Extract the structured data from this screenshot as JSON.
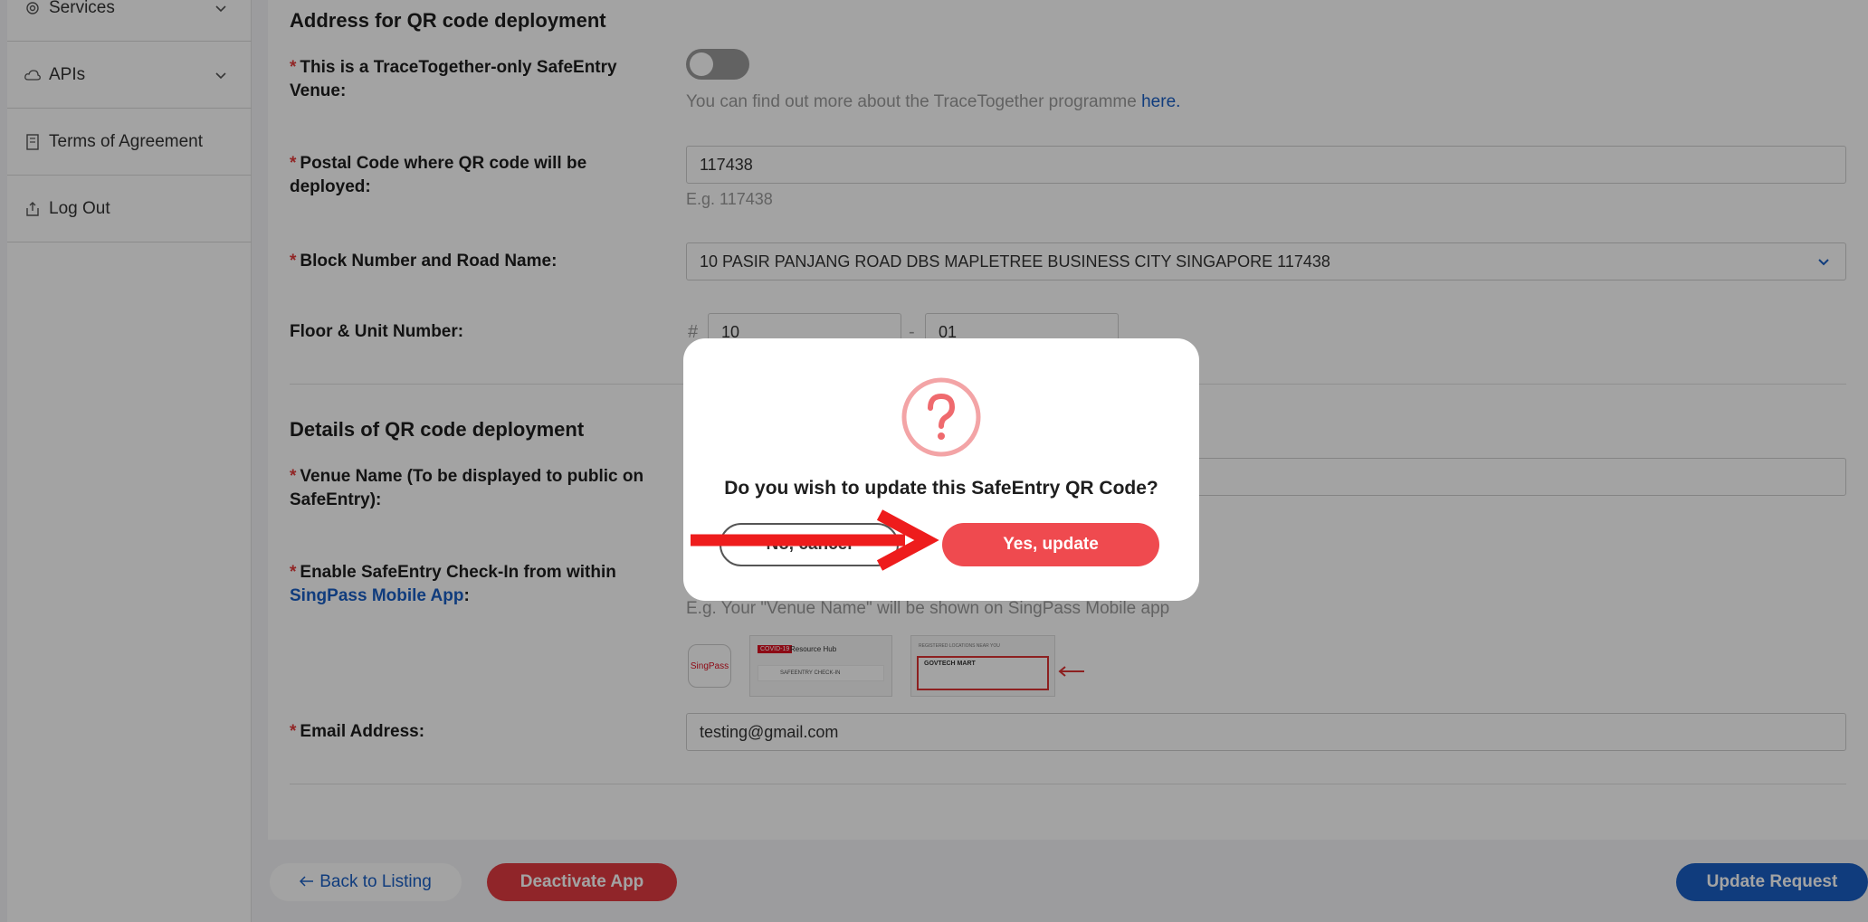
{
  "sidebar": {
    "items": [
      {
        "label": "Services"
      },
      {
        "label": "APIs"
      },
      {
        "label": "Terms of Agreement"
      },
      {
        "label": "Log Out"
      }
    ]
  },
  "address_section": {
    "title": "Address for QR code deployment",
    "tt_only_label": "This is a TraceTogether-only SafeEntry Venue:",
    "tt_hint": "You can find out more about the TraceTogether programme ",
    "tt_hint_link": "here.",
    "postal_label": "Postal Code where QR code will be deployed:",
    "postal_value": "117438",
    "postal_hint": "E.g. 117438",
    "block_label": "Block Number and Road Name:",
    "block_value": "10 PASIR PANJANG ROAD DBS MAPLETREE BUSINESS CITY SINGAPORE 117438",
    "floor_label": "Floor & Unit Number:",
    "hash": "#",
    "floor_value": "10",
    "dash": "-",
    "unit_value": "01"
  },
  "details_section": {
    "title": "Details of QR code deployment",
    "venue_label": "Venue Name (To be displayed to public on SafeEntry):",
    "singpass_label_prefix": "Enable SafeEntry Check-In from within ",
    "singpass_link": "SingPass Mobile App",
    "singpass_label_suffix": ":",
    "singpass_hint": "E.g. Your \"Venue Name\" will be shown on SingPass Mobile app",
    "preview_badge": "COVID-19",
    "preview_hub": "Resource Hub",
    "preview_safeentry": "SAFEENTRY CHECK-IN",
    "preview_govtech_header": "REGISTERED LOCATIONS NEAR YOU",
    "preview_govtech": "GOVTECH MART",
    "singpass_logo": "SingPass",
    "email_label": "Email Address:",
    "email_value": "testing@gmail.com"
  },
  "footer": {
    "back": "Back to Listing",
    "deactivate": "Deactivate App",
    "update": "Update Request"
  },
  "modal": {
    "message": "Do you wish to update this SafeEntry QR Code?",
    "cancel": "No, cancel",
    "confirm": "Yes, update"
  },
  "colors": {
    "accent_red": "#ef4a4f",
    "link_blue": "#1a5fc4",
    "primary_blue": "#1a5fc4",
    "annotation_arrow": "#ee1c1c"
  }
}
